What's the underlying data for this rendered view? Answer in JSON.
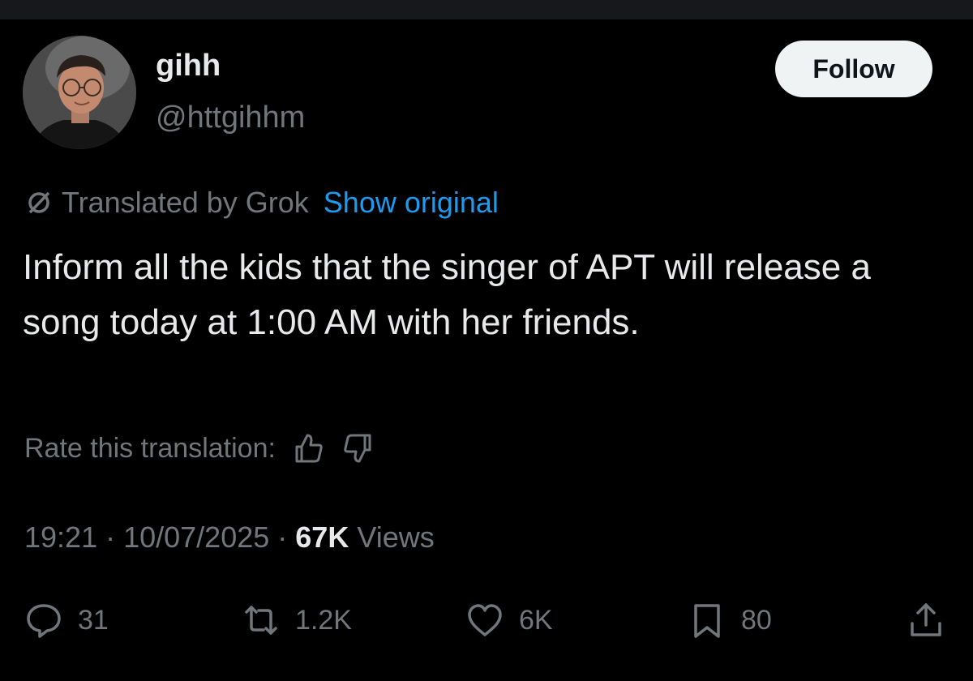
{
  "author": {
    "display_name": "gihh",
    "handle": "@httgihhm",
    "avatar_icon": "profile-photo"
  },
  "follow_label": "Follow",
  "translation": {
    "translated_by": "Translated by Grok",
    "show_original": "Show original"
  },
  "tweet_text": "Inform all the kids that the singer of APT will release a song today at 1:00 AM with her friends.",
  "rate": {
    "label": "Rate this translation:",
    "up_icon": "thumbs-up-icon",
    "down_icon": "thumbs-down-icon"
  },
  "meta": {
    "time": "19:21",
    "date": "10/07/2025",
    "separator": "·",
    "views_count": "67K",
    "views_label": "Views"
  },
  "actions": {
    "replies": "31",
    "reposts": "1.2K",
    "likes": "6K",
    "bookmarks": "80"
  },
  "colors": {
    "background": "#000000",
    "text_primary": "#e7e9ea",
    "text_secondary": "#71767b",
    "link": "#1d9bf0",
    "button_bg": "#eff3f4"
  }
}
